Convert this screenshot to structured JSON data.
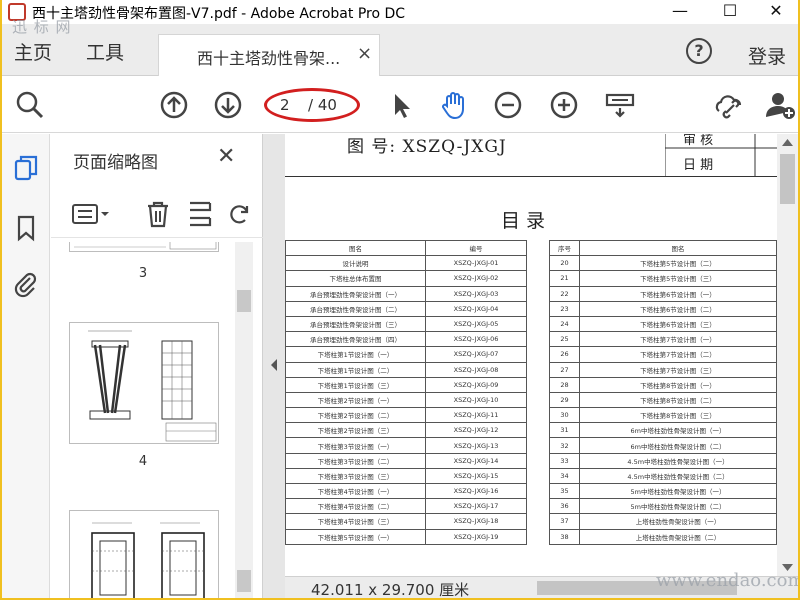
{
  "window": {
    "title": "西十主塔劲性骨架布置图-V7.pdf - Adobe Acrobat Pro DC",
    "minimize": "—",
    "maximize": "☐",
    "close": "✕"
  },
  "nav": {
    "home": "主页",
    "tools": "工具",
    "doc_tab": "西十主塔劲性骨架...",
    "doc_tab_close": "×",
    "help": "?",
    "login": "登录"
  },
  "toolbar": {
    "current_page": "2",
    "total_pages": "/ 40"
  },
  "panel": {
    "title": "页面缩略图",
    "close": "✕",
    "thumbnails": [
      {
        "label": "3"
      },
      {
        "label": "4"
      }
    ]
  },
  "document": {
    "drawing_no": "图 号: XSZQ-JXGJ",
    "check_label": "审    核",
    "date_label": "日    期",
    "heading": "目    录",
    "left_table": {
      "headers": [
        "图名",
        "编号"
      ],
      "rows": [
        [
          "设计说明",
          "XSZQ-JXGJ-01"
        ],
        [
          "下塔柱总体布置图",
          "XSZQ-JXGJ-02"
        ],
        [
          "承台预埋劲性骨架设计图（一）",
          "XSZQ-JXGJ-03"
        ],
        [
          "承台预埋劲性骨架设计图（二）",
          "XSZQ-JXGJ-04"
        ],
        [
          "承台预埋劲性骨架设计图（三）",
          "XSZQ-JXGJ-05"
        ],
        [
          "承台预埋劲性骨架设计图（四）",
          "XSZQ-JXGJ-06"
        ],
        [
          "下塔柱第1节设计图（一）",
          "XSZQ-JXGJ-07"
        ],
        [
          "下塔柱第1节设计图（二）",
          "XSZQ-JXGJ-08"
        ],
        [
          "下塔柱第1节设计图（三）",
          "XSZQ-JXGJ-09"
        ],
        [
          "下塔柱第2节设计图（一）",
          "XSZQ-JXGJ-10"
        ],
        [
          "下塔柱第2节设计图（二）",
          "XSZQ-JXGJ-11"
        ],
        [
          "下塔柱第2节设计图（三）",
          "XSZQ-JXGJ-12"
        ],
        [
          "下塔柱第3节设计图（一）",
          "XSZQ-JXGJ-13"
        ],
        [
          "下塔柱第3节设计图（二）",
          "XSZQ-JXGJ-14"
        ],
        [
          "下塔柱第3节设计图（三）",
          "XSZQ-JXGJ-15"
        ],
        [
          "下塔柱第4节设计图（一）",
          "XSZQ-JXGJ-16"
        ],
        [
          "下塔柱第4节设计图（二）",
          "XSZQ-JXGJ-17"
        ],
        [
          "下塔柱第4节设计图（三）",
          "XSZQ-JXGJ-18"
        ],
        [
          "下塔柱第5节设计图（一）",
          "XSZQ-JXGJ-19"
        ]
      ]
    },
    "right_table": {
      "headers": [
        "序号",
        "图名"
      ],
      "rows": [
        [
          "20",
          "下塔柱第5节设计图（二）"
        ],
        [
          "21",
          "下塔柱第5节设计图（三）"
        ],
        [
          "22",
          "下塔柱第6节设计图（一）"
        ],
        [
          "23",
          "下塔柱第6节设计图（二）"
        ],
        [
          "24",
          "下塔柱第6节设计图（三）"
        ],
        [
          "25",
          "下塔柱第7节设计图（一）"
        ],
        [
          "26",
          "下塔柱第7节设计图（二）"
        ],
        [
          "27",
          "下塔柱第7节设计图（三）"
        ],
        [
          "28",
          "下塔柱第8节设计图（一）"
        ],
        [
          "29",
          "下塔柱第8节设计图（二）"
        ],
        [
          "30",
          "下塔柱第8节设计图（三）"
        ],
        [
          "31",
          "6m中塔柱劲性骨架设计图（一）"
        ],
        [
          "32",
          "6m中塔柱劲性骨架设计图（二）"
        ],
        [
          "33",
          "4.5m中塔柱劲性骨架设计图（一）"
        ],
        [
          "34",
          "4.5m中塔柱劲性骨架设计图（二）"
        ],
        [
          "35",
          "5m中塔柱劲性骨架设计图（一）"
        ],
        [
          "36",
          "5m中塔柱劲性骨架设计图（二）"
        ],
        [
          "37",
          "上塔柱劲性骨架设计图（一）"
        ],
        [
          "38",
          "上塔柱劲性骨架设计图（二）"
        ]
      ]
    }
  },
  "status": {
    "page_size": "42.011 x 29.700 厘米"
  },
  "watermarks": {
    "top_left": "迅  标  网",
    "bottom_right": "www.endao.com"
  }
}
